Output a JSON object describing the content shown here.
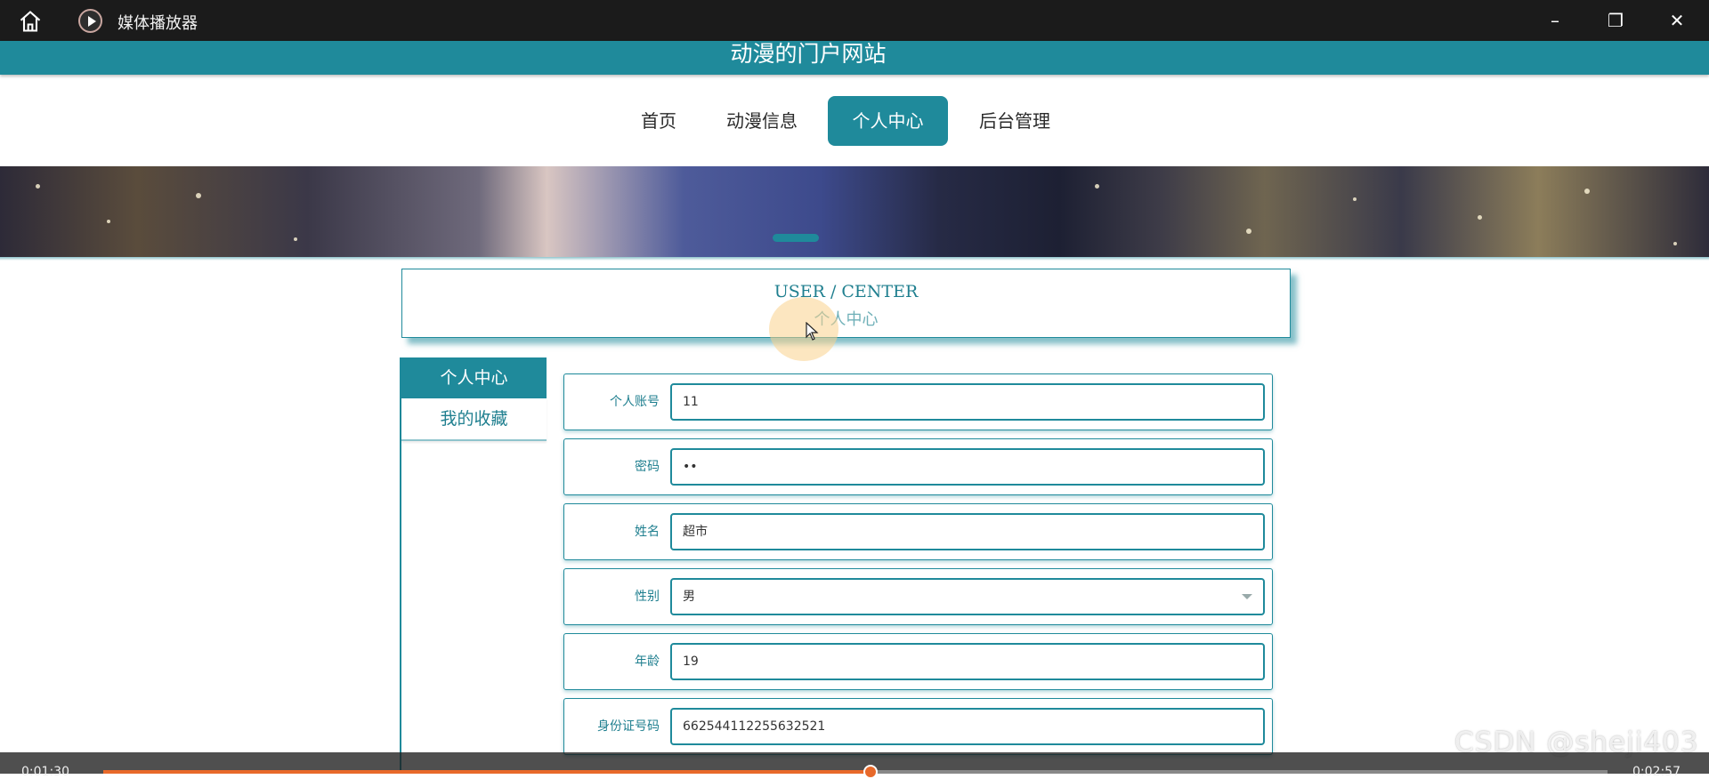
{
  "window": {
    "app_title": "媒体播放器"
  },
  "site": {
    "title": "动漫的门户网站",
    "nav": [
      {
        "label": "首页"
      },
      {
        "label": "动漫信息"
      },
      {
        "label": "个人中心",
        "active": true
      },
      {
        "label": "后台管理"
      }
    ]
  },
  "user_center": {
    "heading_en": "USER / CENTER",
    "heading_cn": "个人中心"
  },
  "sidebar": {
    "items": [
      {
        "label": "个人中心",
        "active": true
      },
      {
        "label": "我的收藏"
      }
    ]
  },
  "form": {
    "fields": [
      {
        "label": "个人账号",
        "value": "11"
      },
      {
        "label": "密码",
        "value": "••"
      },
      {
        "label": "姓名",
        "value": "超市"
      },
      {
        "label": "性别",
        "value": "男"
      },
      {
        "label": "年龄",
        "value": "19"
      },
      {
        "label": "身份证号码",
        "value": "662544112255632521"
      }
    ]
  },
  "watermark": "CSDN @sheji403",
  "player": {
    "elapsed": "0:01:30",
    "total": "0:02:57",
    "progress": 0.51
  },
  "colors": {
    "accent": "#1f8a9b",
    "titlebar": "#1b1b1b",
    "seek": "#e8692a"
  }
}
